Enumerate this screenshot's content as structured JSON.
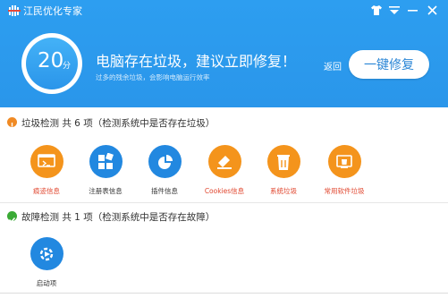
{
  "app": {
    "title": "江民优化专家"
  },
  "header": {
    "score": "20",
    "score_unit": "分",
    "title": "电脑存在垃圾，建议立即修复！",
    "subtitle": "过多的残余垃圾，会影响电脑运行效率",
    "back_label": "返回",
    "fix_button_label": "一键修复"
  },
  "junk_section": {
    "label": "垃圾检测   共   6   项（检测系统中是否存在垃圾）",
    "status_color": "#f08a24",
    "items": [
      {
        "label": "痕迹信息",
        "label_color": "#e0452d",
        "icon": "history-icon"
      },
      {
        "label": "注册表信息",
        "label_color": "#333333",
        "icon": "registry-icon"
      },
      {
        "label": "插件信息",
        "label_color": "#333333",
        "icon": "plugin-icon"
      },
      {
        "label": "Cookies信息",
        "label_color": "#e0452d",
        "icon": "cookies-icon"
      },
      {
        "label": "系统垃圾",
        "label_color": "#e0452d",
        "icon": "system-junk-icon"
      },
      {
        "label": "常用软件垃圾",
        "label_color": "#e0452d",
        "icon": "software-junk-icon"
      }
    ]
  },
  "fault_section": {
    "label": "故障检测   共   1   项（检测系统中是否存在故障）",
    "status_color": "#3aaa35",
    "items": [
      {
        "label": "启动项",
        "label_color": "#333333",
        "icon": "startup-icon"
      }
    ]
  },
  "colors": {
    "header_blue": "#2d9ef0",
    "orange_icon": "#f4941c",
    "blue_icon": "#2288e0"
  }
}
